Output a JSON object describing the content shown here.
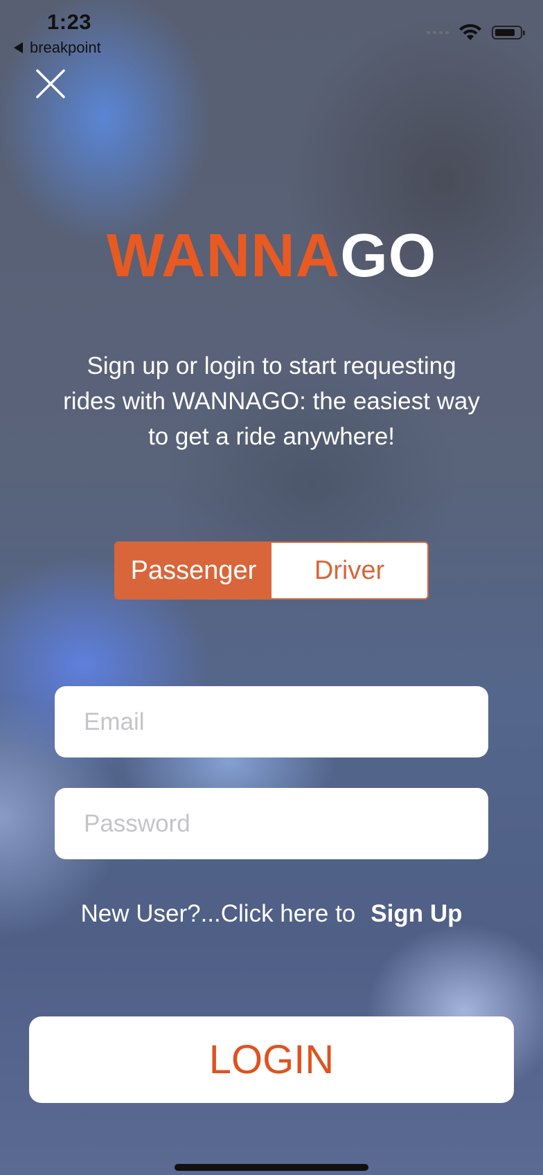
{
  "status_bar": {
    "time": "1:23",
    "back_label": "breakpoint",
    "icons": [
      "signal-icon",
      "wifi-icon",
      "battery-icon"
    ]
  },
  "header": {
    "close_icon": "close-icon"
  },
  "logo": {
    "part1": "WANNA",
    "part2": "GO",
    "part1_color": "#e85a22",
    "part2_color": "#ffffff"
  },
  "tagline": {
    "line1": "Sign up or login to start requesting",
    "line2": "rides with WANNAGO: the easiest way",
    "line3": "to get a ride anywhere!"
  },
  "role_toggle": {
    "options": [
      "Passenger",
      "Driver"
    ],
    "selected": "Passenger",
    "accent_color": "#d8663a"
  },
  "form": {
    "email_placeholder": "Email",
    "email_value": "",
    "password_placeholder": "Password",
    "password_value": ""
  },
  "signup": {
    "prompt": "New User?...Click here to",
    "link_label": "Sign Up"
  },
  "login_button": {
    "label": "LOGIN",
    "text_color": "#e0521f"
  }
}
